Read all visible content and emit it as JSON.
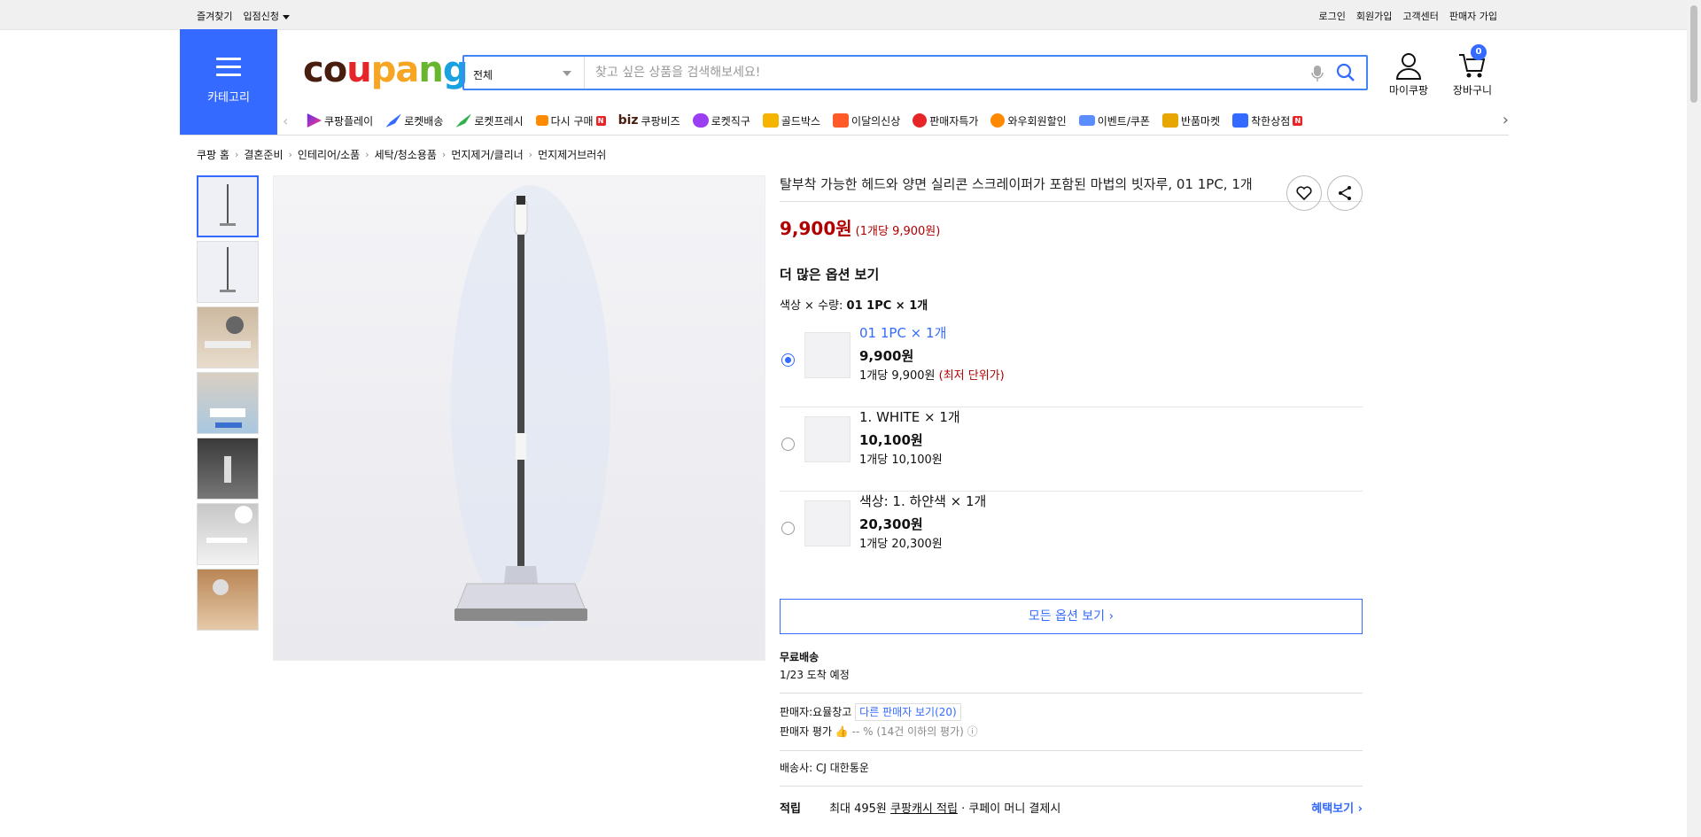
{
  "topbar": {
    "favorites": "즐겨찾기",
    "vendor_apply": "입점신청",
    "login": "로그인",
    "signup": "회원가입",
    "customer_center": "고객센터",
    "seller_signup": "판매자 가입"
  },
  "header": {
    "category_label": "카테고리",
    "logo": "coupang",
    "search_category": "전체",
    "search_placeholder": "찾고 싶은 상품을 검색해보세요!",
    "mycoupang": "마이쿠팡",
    "cart": "장바구니",
    "cart_count": "0"
  },
  "nav": {
    "items": [
      {
        "label": "쿠팡플레이",
        "icon": "play-icon"
      },
      {
        "label": "로켓배송",
        "icon": "rocket-icon"
      },
      {
        "label": "로켓프레시",
        "icon": "rocket-fresh-icon"
      },
      {
        "label": "다시 구매",
        "icon": "rebuy-icon",
        "badge": "N"
      },
      {
        "label": "쿠팡비즈",
        "icon": "biz-icon"
      },
      {
        "label": "로켓직구",
        "icon": "global-icon"
      },
      {
        "label": "골드박스",
        "icon": "goldbox-icon"
      },
      {
        "label": "이달의신상",
        "icon": "new-icon"
      },
      {
        "label": "판매자특가",
        "icon": "percent-icon"
      },
      {
        "label": "와우회원할인",
        "icon": "wow-icon"
      },
      {
        "label": "이벤트/쿠폰",
        "icon": "coupon-icon"
      },
      {
        "label": "반품마켓",
        "icon": "return-market-icon"
      },
      {
        "label": "착한상점",
        "icon": "good-store-icon",
        "badge": "N"
      }
    ],
    "biz_prefix": "biz"
  },
  "breadcrumb": [
    "쿠팡 홈",
    "결혼준비",
    "인테리어/소품",
    "세탁/청소용품",
    "먼지제거/클리너",
    "먼지제거브러쉬"
  ],
  "product": {
    "title": "탈부착 가능한 헤드와 양면 실리콘 스크레이퍼가 포함된 마법의 빗자루, 01 1PC, 1개",
    "price": "9,900원",
    "unit_price": "(1개당 9,900원)",
    "more_options_title": "더 많은 옵션 보기",
    "selected_label": "색상 × 수량:",
    "selected_value": "01 1PC × 1개",
    "options": [
      {
        "name": "01 1PC × 1개",
        "price": "9,900원",
        "unit": "1개당 9,900원",
        "tag": "(최저 단위가)",
        "selected": true
      },
      {
        "name": "1. WHITE × 1개",
        "price": "10,100원",
        "unit": "1개당 10,100원",
        "tag": "",
        "selected": false
      },
      {
        "name": "색상: 1. 하얀색 × 1개",
        "price": "20,300원",
        "unit": "1개당 20,300원",
        "tag": "",
        "selected": false
      }
    ],
    "all_options_button": "모든 옵션 보기 ›",
    "shipping_title": "무료배송",
    "arrival": "1/23 도착 예정",
    "seller_label": "판매자:",
    "seller_name": "요뮬창고",
    "other_sellers": "다른 판매자 보기(20)",
    "seller_rating_label": "판매자 평가",
    "seller_rating_value": "-- % (14건 이하의 평가)",
    "carrier_label": "배송사:",
    "carrier_value": "CJ 대한통운",
    "reward_label": "적립",
    "reward_text1": "최대 495원",
    "reward_link": "쿠팡캐시 적립",
    "reward_text2": "· 쿠페이 머니 결제시",
    "benefit_link": "혜택보기 ›"
  },
  "colors": {
    "brand_blue": "#346aff",
    "price_red": "#ae0000"
  }
}
